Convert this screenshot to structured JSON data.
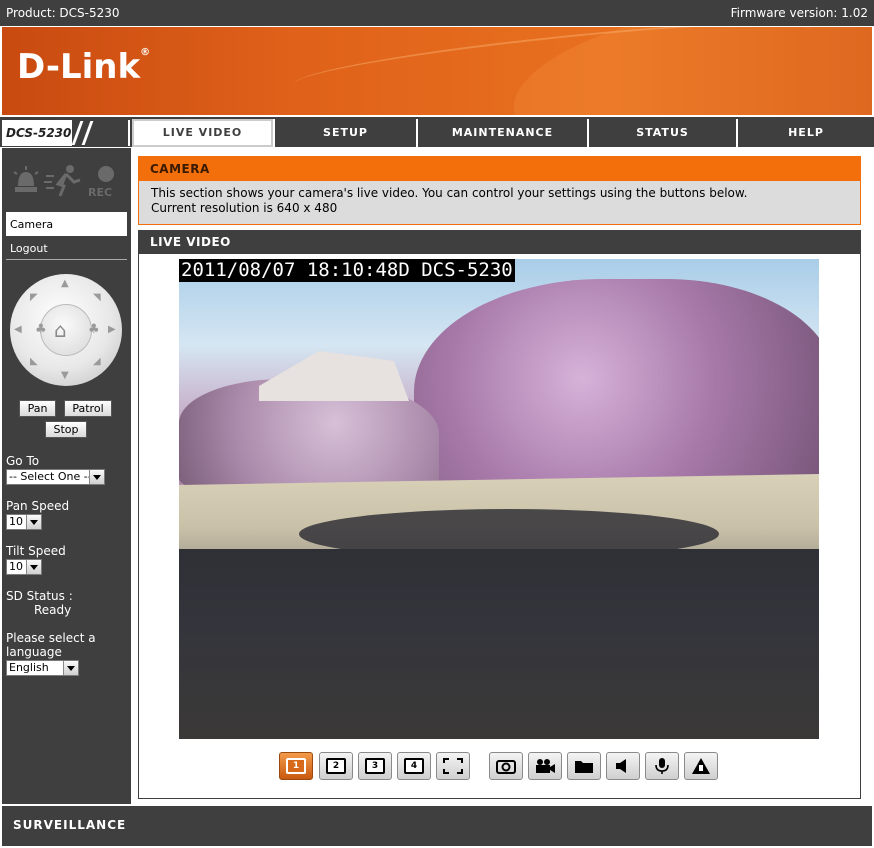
{
  "topbar": {
    "product": "Product: DCS-5230",
    "firmware": "Firmware version: 1.02"
  },
  "brand": {
    "logo": "D-Link",
    "model": "DCS-5230"
  },
  "nav": {
    "tabs": [
      "LIVE VIDEO",
      "SETUP",
      "MAINTENANCE",
      "STATUS",
      "HELP"
    ],
    "active": "LIVE VIDEO"
  },
  "sidebar": {
    "rec_label": "REC",
    "menu": [
      "Camera",
      "Logout"
    ],
    "ptz_buttons": {
      "pan": "Pan",
      "patrol": "Patrol",
      "stop": "Stop"
    },
    "goto": {
      "label": "Go To",
      "value": "-- Select One --"
    },
    "pan_speed": {
      "label": "Pan Speed",
      "value": "10"
    },
    "tilt_speed": {
      "label": "Tilt Speed",
      "value": "10"
    },
    "sd_status": {
      "label": "SD Status :",
      "value": "Ready"
    },
    "language": {
      "label": "Please select a language",
      "value": "English"
    }
  },
  "camera_section": {
    "title": "CAMERA",
    "line1": "This section shows your camera's live video. You can control your settings using the buttons below.",
    "line2": "Current resolution is 640 x 480"
  },
  "live_video": {
    "title": "LIVE VIDEO",
    "osd": "2011/08/07 18:10:48D DCS-5230"
  },
  "toolbar": {
    "buttons": [
      {
        "name": "view-1-button",
        "glyph": "1"
      },
      {
        "name": "view-2-button",
        "glyph": "2"
      },
      {
        "name": "view-3-button",
        "glyph": "3"
      },
      {
        "name": "view-4-button",
        "glyph": "4"
      },
      {
        "name": "fullscreen-button",
        "glyph": ""
      },
      {
        "name": "snapshot-button",
        "glyph": ""
      },
      {
        "name": "record-button",
        "glyph": ""
      },
      {
        "name": "folder-button",
        "glyph": ""
      },
      {
        "name": "speaker-button",
        "glyph": ""
      },
      {
        "name": "microphone-button",
        "glyph": ""
      },
      {
        "name": "alarm-button",
        "glyph": ""
      }
    ]
  },
  "footer": {
    "label": "SURVEILLANCE"
  }
}
